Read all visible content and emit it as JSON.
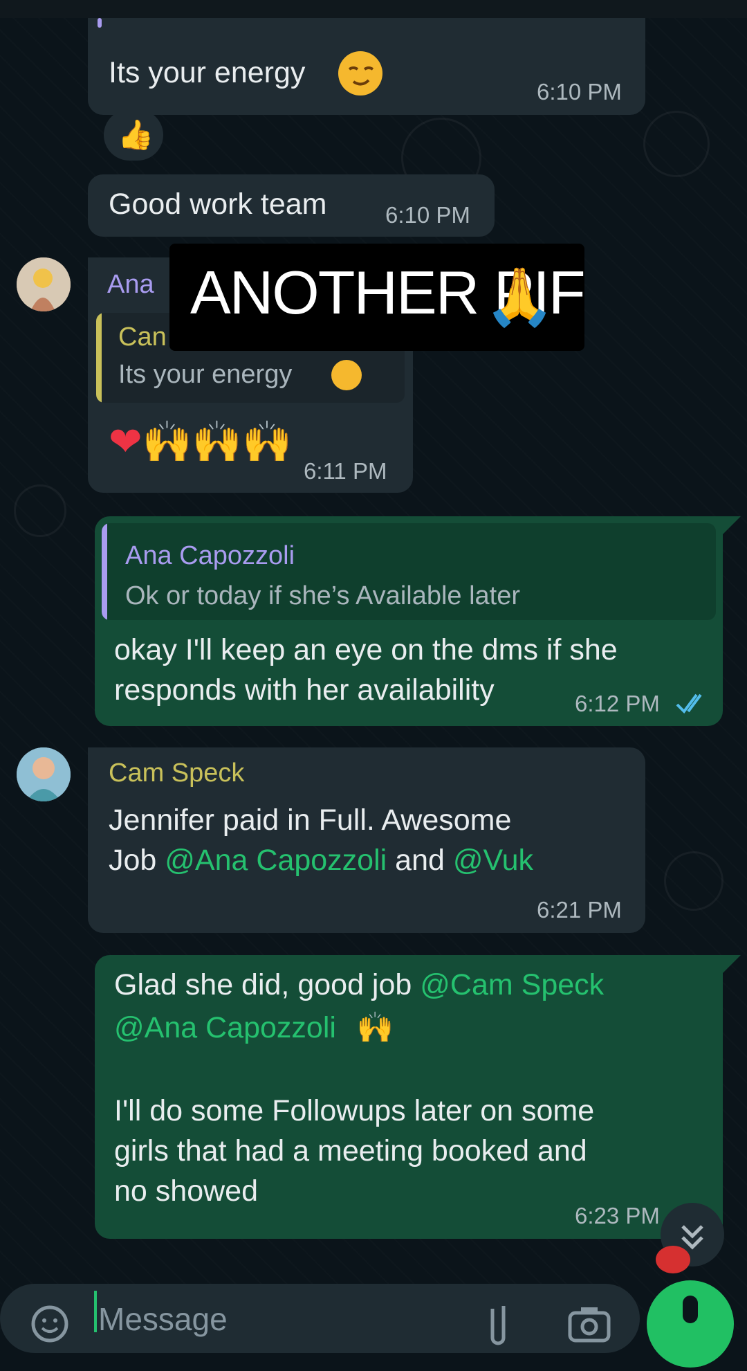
{
  "messages": [
    {
      "text": "Its your energy",
      "emoji": "☺",
      "time": "6:10 PM"
    },
    {
      "reaction": "👍"
    },
    {
      "text": "Good work team",
      "time": "6:10 PM"
    },
    {
      "sender": "Ana",
      "quote_name": "Can",
      "quote_text": "Its your energy",
      "quote_emoji": "☺",
      "text": "❤🙌🙌🙌",
      "time": "6:11 PM"
    },
    {
      "quote_name": "Ana Capozzoli",
      "quote_text": "Ok or today if she’s Available later",
      "line1": "okay I'll keep an eye on the dms if she",
      "line2": "responds with her availability",
      "time": "6:12 PM",
      "status_icon": "double-check-icon"
    },
    {
      "sender": "Cam Speck",
      "line1": "Jennifer paid in Full. Awesome",
      "line2_a": "Job ",
      "mention1": "@Ana Capozzoli",
      "line2_b": " and ",
      "mention2": "@Vuk",
      "time": "6:21 PM"
    },
    {
      "line1_a": "Glad she did, good job ",
      "mention1": "@Cam Speck",
      "mention2": "@Ana Capozzoli",
      "emoji": "🙌",
      "line3": "I'll do some Followups later on some",
      "line4": "girls that had a meeting booked and",
      "line5": "no showed",
      "time": "6:23 PM"
    }
  ],
  "overlay": {
    "text": "ANOTHER PIF",
    "emoji": "🙏"
  },
  "input": {
    "placeholder": "Message"
  },
  "colors": {
    "incoming": "#202c33",
    "outgoing": "#144d37",
    "mention": "#25c16f",
    "ana": "#a99cf0",
    "cam": "#c9c15a"
  }
}
